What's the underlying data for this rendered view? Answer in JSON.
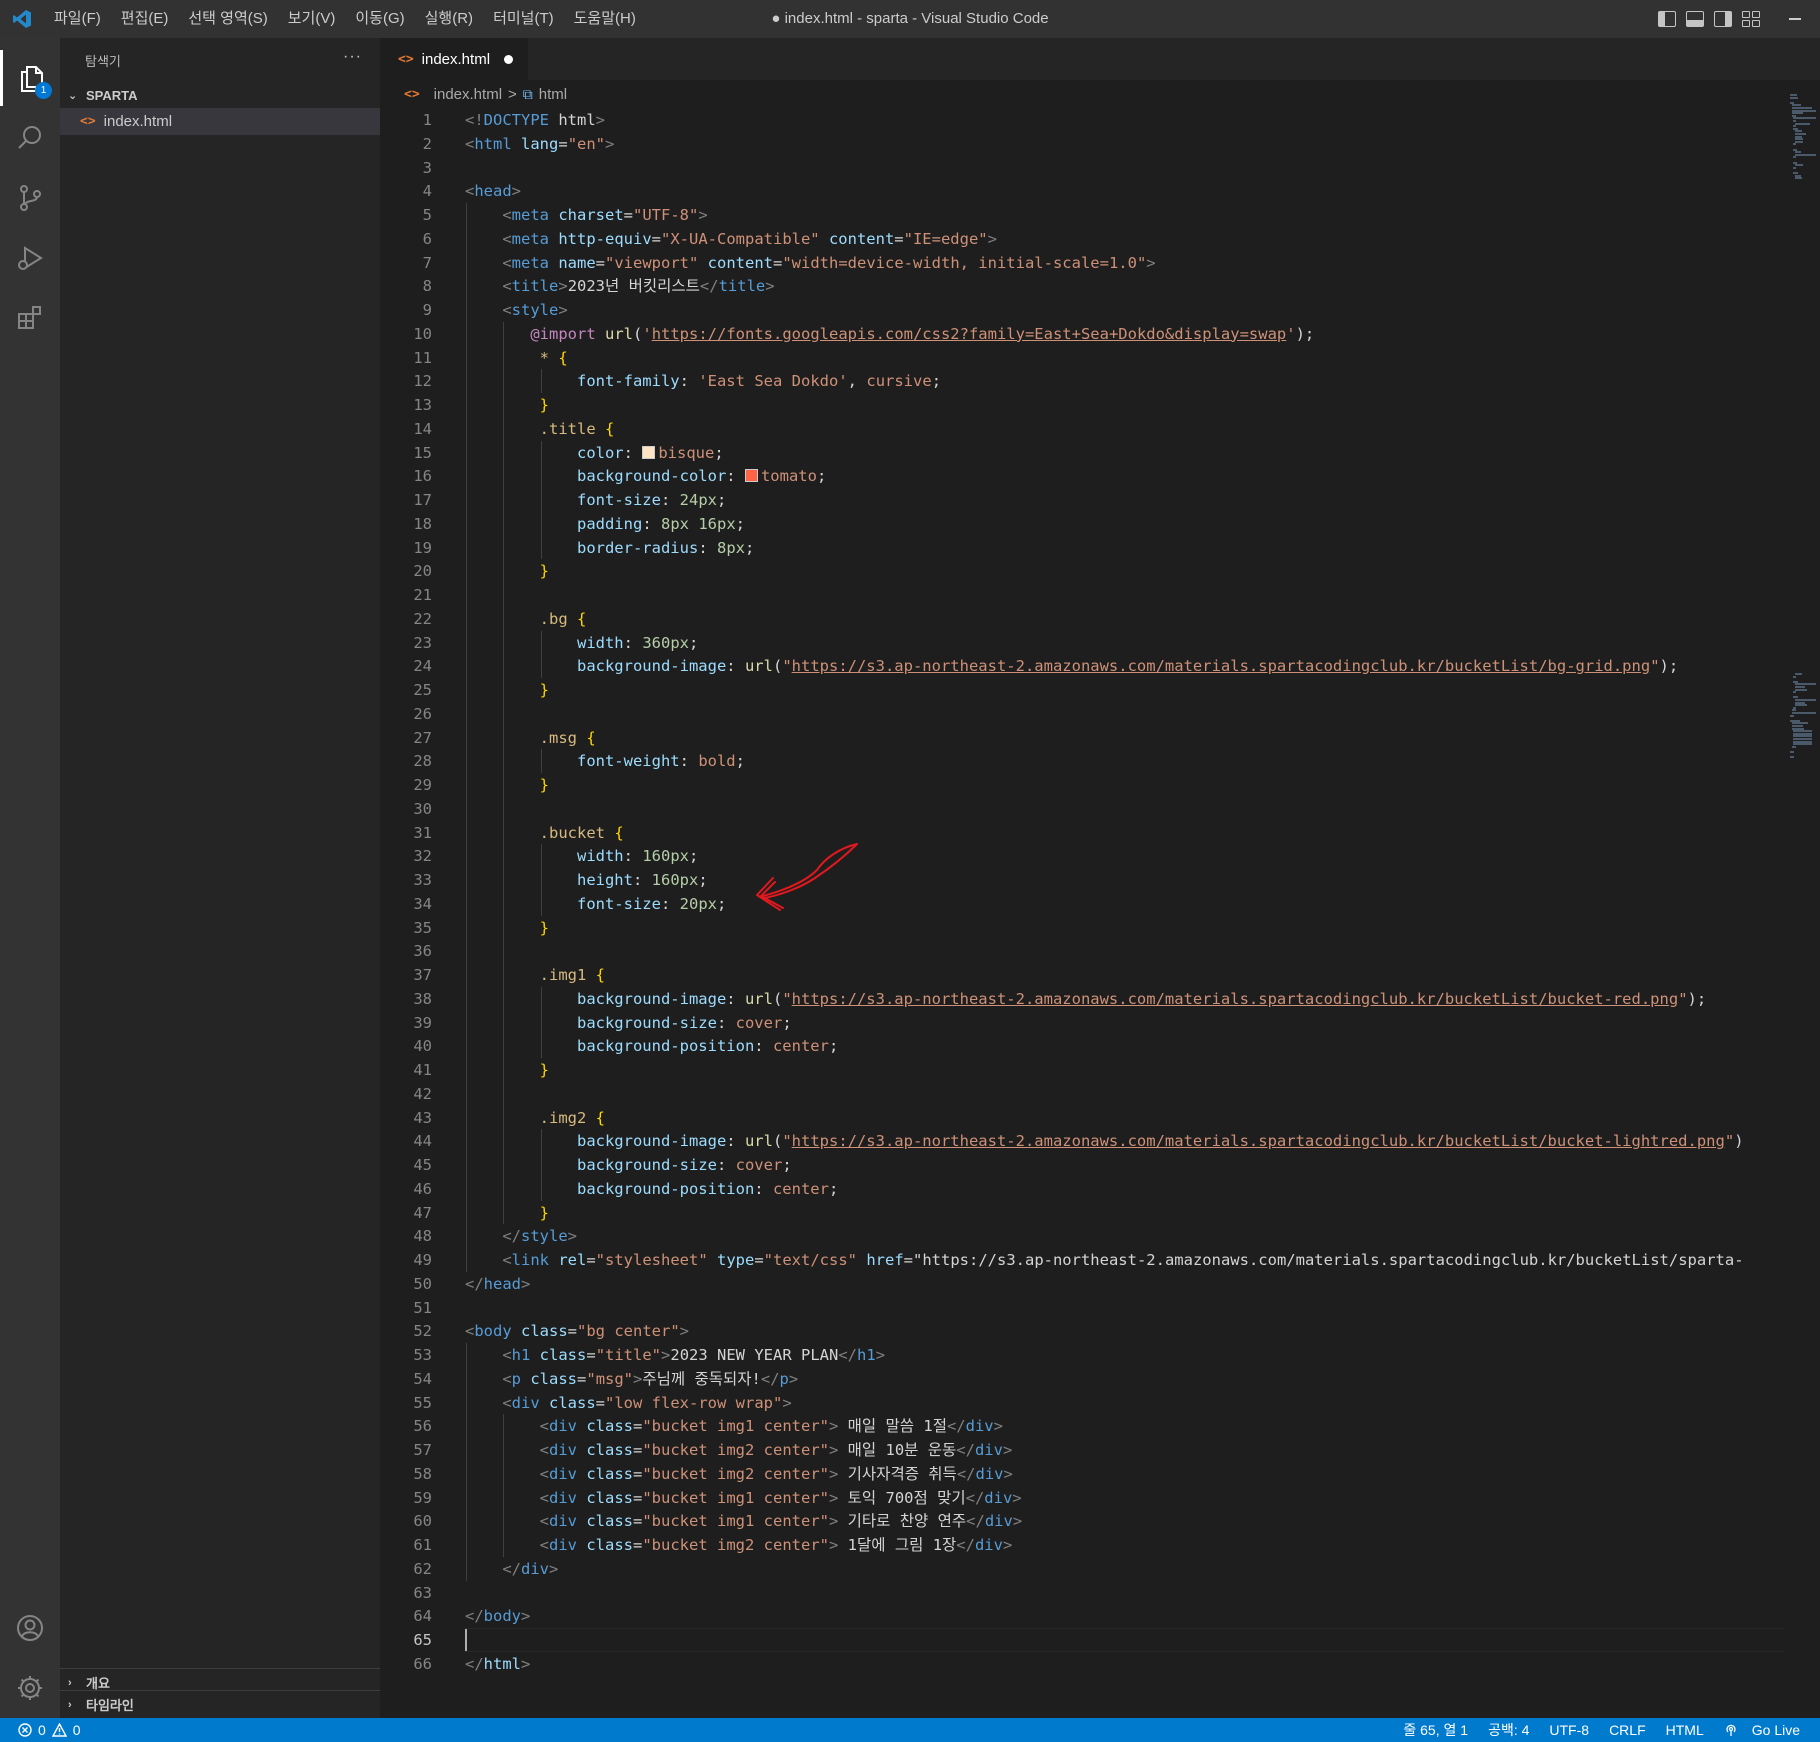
{
  "window": {
    "title": "● index.html - sparta - Visual Studio Code",
    "menu": [
      "파일(F)",
      "편집(E)",
      "선택 영역(S)",
      "보기(V)",
      "이동(G)",
      "실행(R)",
      "터미널(T)",
      "도움말(H)"
    ]
  },
  "activity_bar": {
    "explorer_badge": "1",
    "icons": [
      "files-icon",
      "search-icon",
      "source-control-icon",
      "run-debug-icon",
      "extensions-icon",
      "account-icon",
      "settings-gear-icon"
    ]
  },
  "sidebar": {
    "title": "탐색기",
    "more": "···",
    "folder": "SPARTA",
    "files": [
      "index.html"
    ],
    "bottom_sections": [
      "개요",
      "타임라인"
    ]
  },
  "tabs": [
    {
      "label": "index.html",
      "modified": true
    }
  ],
  "breadcrumb": {
    "file": "index.html",
    "separator": ">",
    "symbol": "html"
  },
  "editor": {
    "current_line": 65,
    "lines": [
      "<!DOCTYPE html>",
      "<html lang=\"en\">",
      "",
      "<head>",
      "    <meta charset=\"UTF-8\">",
      "    <meta http-equiv=\"X-UA-Compatible\" content=\"IE=edge\">",
      "    <meta name=\"viewport\" content=\"width=device-width, initial-scale=1.0\">",
      "    <title>2023년 버킷리스트</title>",
      "    <style>",
      "       @import url('https://fonts.googleapis.com/css2?family=East+Sea+Dokdo&display=swap');",
      "        * {",
      "            font-family: 'East Sea Dokdo', cursive;",
      "        }",
      "        .title {",
      "            color: bisque;",
      "            background-color: tomato;",
      "            font-size: 24px;",
      "            padding: 8px 16px;",
      "            border-radius: 8px;",
      "        }",
      "",
      "        .bg {",
      "            width: 360px;",
      "            background-image: url(\"https://s3.ap-northeast-2.amazonaws.com/materials.spartacodingclub.kr/bucketList/bg-grid.png\");",
      "        }",
      "",
      "        .msg {",
      "            font-weight: bold;",
      "        }",
      "",
      "        .bucket {",
      "            width: 160px;",
      "            height: 160px;",
      "            font-size: 20px;",
      "        }",
      "",
      "        .img1 {",
      "            background-image: url(\"https://s3.ap-northeast-2.amazonaws.com/materials.spartacodingclub.kr/bucketList/bucket-red.png\");",
      "            background-size: cover;",
      "            background-position: center;",
      "        }",
      "",
      "        .img2 {",
      "            background-image: url(\"https://s3.ap-northeast-2.amazonaws.com/materials.spartacodingclub.kr/bucketList/bucket-lightred.png\")",
      "            background-size: cover;",
      "            background-position: center;",
      "        }",
      "    </style>",
      "    <link rel=\"stylesheet\" type=\"text/css\" href=\"https://s3.ap-northeast-2.amazonaws.com/materials.spartacodingclub.kr/bucketList/sparta-",
      "</head>",
      "",
      "<body class=\"bg center\">",
      "    <h1 class=\"title\">2023 NEW YEAR PLAN</h1>",
      "    <p class=\"msg\">주님께 중독되자!</p>",
      "    <div class=\"low flex-row wrap\">",
      "        <div class=\"bucket img1 center\"> 매일 말씀 1절</div>",
      "        <div class=\"bucket img2 center\"> 매일 10분 운동</div>",
      "        <div class=\"bucket img2 center\"> 기사자격증 취득</div>",
      "        <div class=\"bucket img1 center\"> 토익 700점 맞기</div>",
      "        <div class=\"bucket img1 center\"> 기타로 찬양 연주</div>",
      "        <div class=\"bucket img2 center\"> 1달에 그림 1장</div>",
      "    </div>",
      "",
      "</body>",
      "",
      "</html>"
    ]
  },
  "colors": {
    "bisque": "#ffe4c4",
    "tomato": "#ff6347",
    "accent": "#007acc",
    "annotation_arrow": "#e0191f"
  },
  "status_bar": {
    "errors": "0",
    "warnings": "0",
    "position": "줄 65, 열 1",
    "spaces": "공백: 4",
    "encoding": "UTF-8",
    "eol": "CRLF",
    "language": "HTML",
    "golive": "Go Live"
  }
}
